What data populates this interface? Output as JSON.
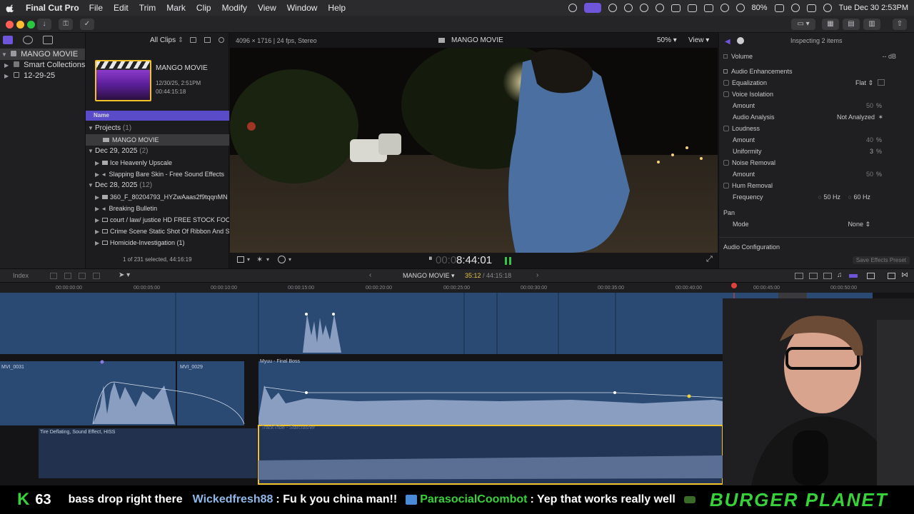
{
  "menubar": {
    "app_name": "Final Cut Pro",
    "menus": [
      "File",
      "Edit",
      "Trim",
      "Mark",
      "Clip",
      "Modify",
      "View",
      "Window",
      "Help"
    ],
    "battery": "80%",
    "datetime": "Tue Dec 30  2:53PM"
  },
  "browser": {
    "library_name": "MANGO MOVIE",
    "library_items": [
      "Smart Collections",
      "12-29-25"
    ],
    "filter": "All Clips",
    "project_title": "MANGO MOVIE",
    "project_date": "12/30/25, 2:51PM",
    "project_duration": "00:44:15:18",
    "column_name": "Name",
    "groups": [
      {
        "label": "Projects",
        "count": "(1)",
        "items": [
          "MANGO MOVIE"
        ]
      },
      {
        "label": "Dec 29, 2025",
        "count": "(2)",
        "items": [
          "Ice Heavenly Upscale",
          "Slapping Bare Skin - Free Sound Effects"
        ]
      },
      {
        "label": "Dec 28, 2025",
        "count": "(12)",
        "items": [
          "360_F_80204793_HYZwAaas2f9tqqnMN",
          "Breaking Bulletin",
          "court / law/ justice HD FREE STOCK FOO",
          "Crime Scene Static Shot Of Ribbon And S",
          "Homicide-Investigation (1)"
        ]
      }
    ],
    "selection_status": "1 of 231 selected, 44:16:19"
  },
  "viewer": {
    "format": "4096 × 1716 | 24 fps, Stereo",
    "title": "MANGO MOVIE",
    "zoom": "50%",
    "view_label": "View",
    "timecode": "8:44:01",
    "timecode_dim": "00:0"
  },
  "inspector": {
    "header": "Inspecting 2 items",
    "volume_label": "Volume",
    "volume_value": "-- dB",
    "section": "Audio Enhancements",
    "equalization": "Equalization",
    "eq_value": "Flat",
    "voice_isolation": "Voice Isolation",
    "amount": "Amount",
    "amount_50": "50",
    "pct": "%",
    "audio_analysis": "Audio Analysis",
    "not_analyzed": "Not Analyzed",
    "loudness": "Loudness",
    "amount_40": "40",
    "uniformity": "Uniformity",
    "uniformity_val": "3",
    "noise_removal": "Noise Removal",
    "hum_removal": "Hum Removal",
    "frequency": "Frequency",
    "hz50": "50 Hz",
    "hz60": "60 Hz",
    "pan": "Pan",
    "mode": "Mode",
    "mode_value": "None",
    "audio_config": "Audio Configuration",
    "save_preset": "Save Effects Preset"
  },
  "timeline": {
    "index_label": "Index",
    "project": "MANGO MOVIE",
    "position": "35:12",
    "duration": "44:15:18",
    "ticks": [
      "00:00:00:00",
      "00:00:05:00",
      "00:00:10:00",
      "00:00:15:00",
      "00:00:20:00",
      "00:00:25:00",
      "00:00:30:00",
      "00:00:35:00",
      "00:00:40:00",
      "00:00:45:00",
      "00:00:50:00"
    ],
    "clips": {
      "mvi31": "MVI_0031",
      "mvi29": "MVI_0029",
      "myuu": "Myuu - Final Boss",
      "tire": "Tire Deflating, Sound Effect, HISS",
      "track": "TrackTribe - Starcrasher"
    }
  },
  "chat": {
    "counter_letter": "K",
    "counter_value": "63",
    "msg1": "bass drop right there",
    "user2": "Wickedfresh88",
    "msg2": ": Fu k you china man!!",
    "user3": "ParasocialCoombot",
    "msg3": ": Yep that works really well",
    "banner": "BURGER PLANET"
  },
  "colors": {
    "accent": "#6f55d9",
    "chat_green": "#37d13a",
    "clip_blue": "#2b4a73",
    "selection_yellow": "#f2c22a"
  }
}
